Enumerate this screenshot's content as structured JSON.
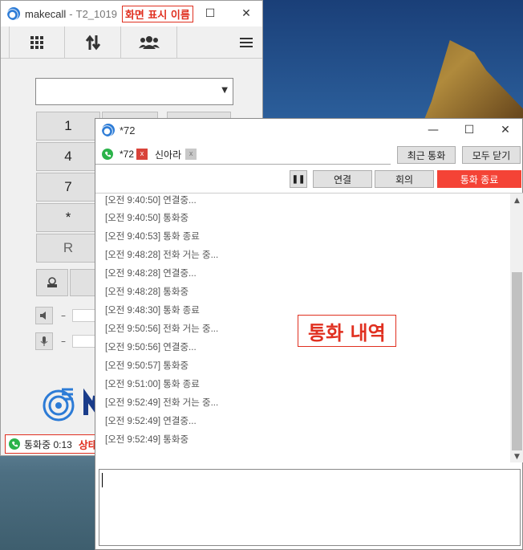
{
  "main_window": {
    "app_name": "makecall",
    "separator": "-",
    "extension": "T2_1019",
    "display_name_label": "화면 표시 이름",
    "tabs": [
      {
        "icon": "dialpad-icon"
      },
      {
        "icon": "transfer-arrows-icon"
      },
      {
        "icon": "contacts-icon"
      }
    ],
    "dialpad_keys": [
      "1",
      "4",
      "7",
      "*",
      "R"
    ],
    "speaker_dash": "–",
    "mic_dash": "–",
    "status_text": "통화중 0:13",
    "status_label": "상태표시"
  },
  "call_window": {
    "title": "*72",
    "channel_tabs": [
      {
        "label": "*72",
        "close": "x"
      },
      {
        "label": "신아라",
        "close": "x"
      }
    ],
    "recent_calls_button": "최근 통화",
    "close_all_button": "모두 닫기",
    "pause_button": "❚❚",
    "connect_button": "연결",
    "conference_button": "회의",
    "end_call_button": "통화 종료",
    "history_label": "통화 내역",
    "log": [
      "[오전 9:40:50]  연결중...",
      "[오전 9:40:50]  통화중",
      "[오전 9:40:53]  통화 종료",
      "[오전 9:48:28]  전화 거는 중...",
      "[오전 9:48:28]  연결중...",
      "[오전 9:48:28]  통화중",
      "[오전 9:48:30]  통화 종료",
      "[오전 9:50:56]  전화 거는 중...",
      "[오전 9:50:56]  연결중...",
      "[오전 9:50:57]  통화중",
      "[오전 9:51:00]  통화 종료",
      "[오전 9:52:49]  전화 거는 중...",
      "[오전 9:52:49]  연결중...",
      "[오전 9:52:49]  통화중"
    ]
  },
  "colors": {
    "end_call_bg": "#f44336",
    "annotation_red": "#e03020",
    "status_green": "#2bb34a"
  }
}
